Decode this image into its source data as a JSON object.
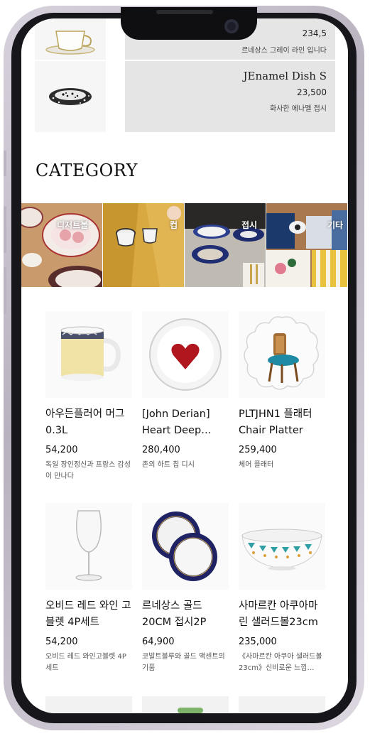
{
  "recent_items": [
    {
      "title": "",
      "price": "234,5",
      "desc": "르네상스 그레이 라인 입니다"
    },
    {
      "title": "JEnamel Dish S",
      "price": "23,500",
      "desc": "화사한 에나멜 접시"
    }
  ],
  "category": {
    "heading": "CATEGORY",
    "tiles": [
      {
        "label": "디저트볼"
      },
      {
        "label": "컵"
      },
      {
        "label": "접시"
      },
      {
        "label": "기타"
      }
    ]
  },
  "products": [
    {
      "name": "아우든플러어 머그 0.3L",
      "price": "54,200",
      "desc": "독일 장인정신과 프랑스 감성이 만나다",
      "icon": "mug-icon"
    },
    {
      "name": "[John Derian] Heart Deep…",
      "price": "280,400",
      "desc": "존의 하트 칩 디시",
      "icon": "heart-dish-icon"
    },
    {
      "name": "PLTJHN1 플래터 Chair Platter",
      "price": "259,400",
      "desc": "체어 플래터",
      "icon": "chair-platter-icon"
    },
    {
      "name": "오비드 레드 와인 고블렛 4P세트",
      "price": "54,200",
      "desc": "오비드 레드 와인고블렛 4P세트",
      "icon": "wine-glass-icon"
    },
    {
      "name": "르네상스 골드 20CM 접시2P",
      "price": "64,900",
      "desc": "코발트블루와 골드 액센트의 기품",
      "icon": "plates-icon"
    },
    {
      "name": "사마르칸 아쿠아마린 샐러드볼23cm",
      "price": "235,000",
      "desc": "《사마르칸 아쿠아 샐러드볼23cm》신비로운 느낌…",
      "icon": "salad-bowl-icon"
    }
  ]
}
